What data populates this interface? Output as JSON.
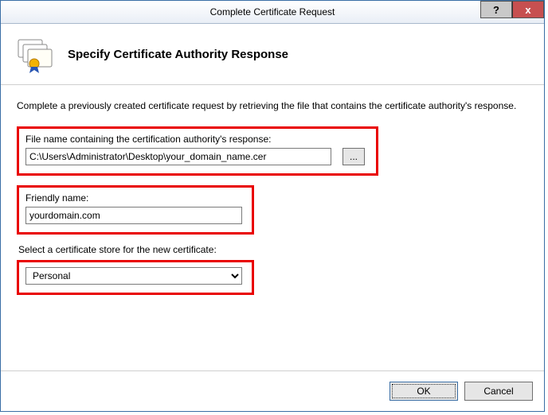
{
  "window": {
    "title": "Complete Certificate Request",
    "help_tooltip": "?",
    "close_tooltip": "x"
  },
  "header": {
    "heading": "Specify Certificate Authority Response"
  },
  "body": {
    "intro": "Complete a previously created certificate request by retrieving the file that contains the certificate authority's response.",
    "file_label": "File name containing the certification authority's response:",
    "file_value": "C:\\Users\\Administrator\\Desktop\\your_domain_name.cer",
    "browse_label": "...",
    "friendly_label": "Friendly name:",
    "friendly_value": "yourdomain.com",
    "store_label": "Select a certificate store for the new certificate:",
    "store_selected": "Personal"
  },
  "footer": {
    "ok": "OK",
    "cancel": "Cancel"
  }
}
